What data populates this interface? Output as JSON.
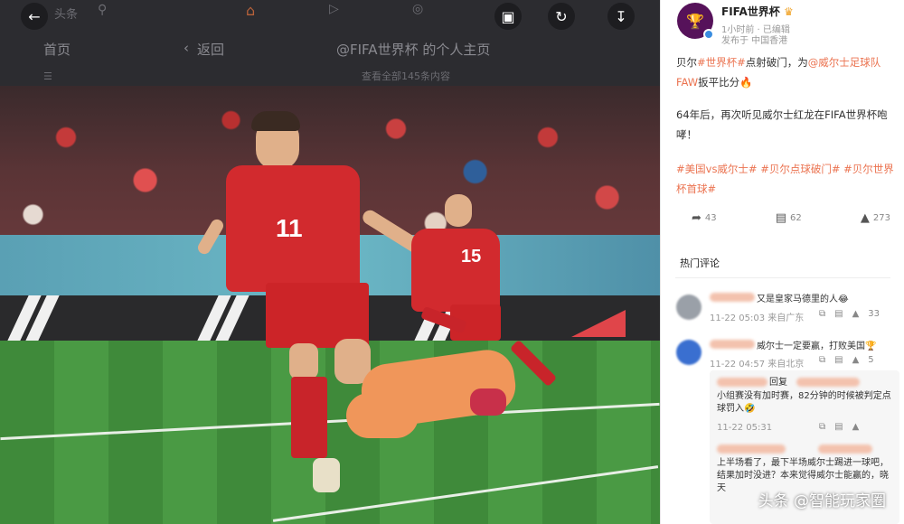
{
  "viewer": {
    "site_logo": "头条",
    "nav_home": "首页",
    "back_label": "返回",
    "profile_title": "@FIFA世界杯 的个人主页",
    "ghost_sub": "查看全部145条内容"
  },
  "account": {
    "name": "FIFA世界杯",
    "time": "1小时前 · 已编辑",
    "location": "发布于 中国香港"
  },
  "post": {
    "line1_pre": "贝尔",
    "line1_tag": "#世界杯#",
    "line1_mid": "点射破门，为",
    "line1_mention": "@威尔士足球队FAW",
    "line1_post": "扳平比分🔥",
    "line2": "64年后，再次听见威尔士红龙在FIFA世界杯咆哮！",
    "tags": "#美国vs威尔士# #贝尔点球破门# #贝尔世界杯首球#"
  },
  "actions": {
    "share": "43",
    "comment": "62",
    "like": "273"
  },
  "comments_title": "热门评论",
  "comments": [
    {
      "text": "又是皇家马德里的人😂",
      "time": "11-22 05:03 来自广东",
      "likes": "33",
      "avatar_color": "#9aa0a8"
    },
    {
      "text": "威尔士一定要赢，打败美国🏆",
      "time": "11-22 04:57 来自北京",
      "likes": "5",
      "avatar_color": "#3a6fd0"
    }
  ],
  "reply": {
    "line1": "回复",
    "line2": "小组赛没有加时赛，82分钟的时候被判定点球罚入🤣",
    "time": "11-22 05:31",
    "line3": "上半场看了，最下半场威尔士踢进一球吧，结果加时没进？本来觉得威尔士能赢的，晓天"
  },
  "watermark": "头条 @智能玩家圈"
}
